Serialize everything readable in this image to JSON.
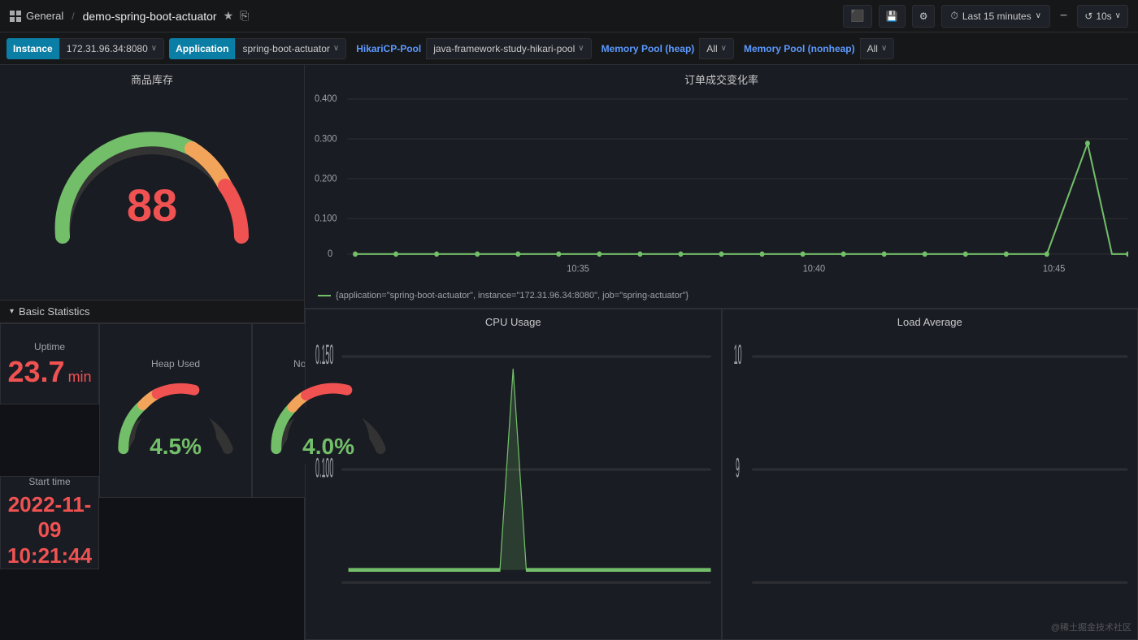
{
  "topbar": {
    "logo_icon": "grid",
    "general_label": "General",
    "separator": "/",
    "dashboard_name": "demo-spring-boot-actuator",
    "star_icon": "★",
    "share_icon": "⎘",
    "add_panel_icon": "📊",
    "save_icon": "💾",
    "settings_icon": "⚙",
    "time_range_icon": "⏱",
    "time_range_label": "Last 15 minutes",
    "time_range_arrow": "∨",
    "zoom_out_icon": "−",
    "refresh_icon": "↺",
    "refresh_interval": "10s",
    "refresh_arrow": "∨"
  },
  "filterbar": {
    "instance_label": "Instance",
    "instance_value": "172.31.96.34:8080",
    "instance_arrow": "∨",
    "application_label": "Application",
    "application_value": "spring-boot-actuator",
    "application_arrow": "∨",
    "hikari_label": "HikariCP-Pool",
    "hikari_value": "java-framework-study-hikari-pool",
    "hikari_arrow": "∨",
    "memory_heap_label": "Memory Pool (heap)",
    "memory_heap_value": "All",
    "memory_heap_arrow": "∨",
    "memory_nonheap_label": "Memory Pool (nonheap)",
    "memory_nonheap_value": "All",
    "memory_nonheap_arrow": "∨"
  },
  "left_panel": {
    "gauge_title": "商品库存",
    "gauge_value": "88"
  },
  "basic_stats": {
    "section_label": "Basic Statistics",
    "uptime_title": "Uptime",
    "uptime_value": "23.7",
    "uptime_unit": "min",
    "start_time_title": "Start time",
    "start_date": "2022-11-09",
    "start_time": "10:21:44",
    "heap_title": "Heap Used",
    "heap_value": "4.5%",
    "nonheap_title": "Non-Heap Used",
    "nonheap_value": "4.0%"
  },
  "order_chart": {
    "title": "订单成交变化率",
    "y_labels": [
      "0.400",
      "0.300",
      "0.200",
      "0.100",
      "0"
    ],
    "x_labels": [
      "10:35",
      "10:40",
      "10:45"
    ],
    "legend_text": "{application=\"spring-boot-actuator\", instance=\"172.31.96.34:8080\", job=\"spring-actuator\"}"
  },
  "cpu_chart": {
    "title": "CPU Usage",
    "y_labels": [
      "0.150",
      "0.100"
    ]
  },
  "load_chart": {
    "title": "Load Average",
    "y_labels": [
      "10",
      "9"
    ]
  },
  "watermark": "@稀土掘金技术社区"
}
